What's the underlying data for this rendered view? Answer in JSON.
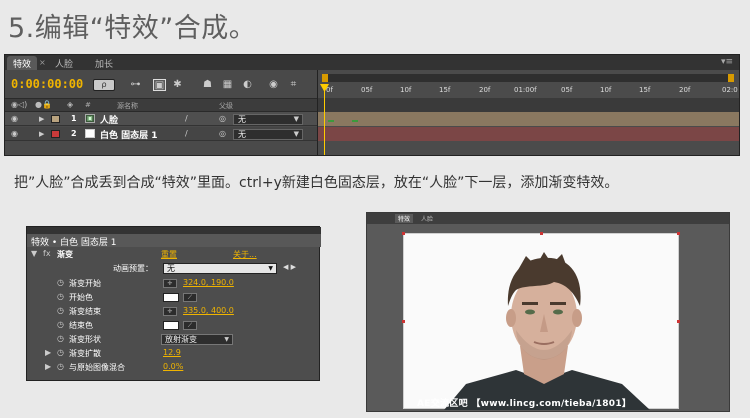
{
  "heading": "5.编辑“特效”合成。",
  "timeline": {
    "tabs": [
      "特效",
      "人脸",
      "加长"
    ],
    "menu_icon": "panel-menu-icon",
    "timecode": "0:00:00:00",
    "search_placeholder": "ρ",
    "columns": {
      "number": "#",
      "source_name": "源名称",
      "parent": "父级"
    },
    "ruler_ticks": [
      "0f",
      "05f",
      "10f",
      "15f",
      "20f",
      "01:00f",
      "05f",
      "10f",
      "15f",
      "20f",
      "02:0"
    ],
    "layers": [
      {
        "num": "1",
        "name": "人脸",
        "color": "#b9a37f",
        "switch": "/",
        "parent": "无"
      },
      {
        "num": "2",
        "name": "白色 固态层 1",
        "color": "#c83a3a",
        "switch": "/",
        "parent": "无"
      }
    ]
  },
  "description": "把”人脸”合成丢到合成“特效”里面。ctrl+y新建白色固态层，放在“人脸”下一层，添加渐变特效。",
  "effect_controls": {
    "header": "特效 • 白色 固态层 1",
    "effect_name": "渐变",
    "reset": "重置",
    "about": "关于...",
    "preset_label": "动画预置：",
    "preset_value": "无",
    "props": [
      {
        "label": "渐变开始",
        "type": "point",
        "value": "324.0, 190.0"
      },
      {
        "label": "开始色",
        "type": "color",
        "value": "#ffffff"
      },
      {
        "label": "渐变结束",
        "type": "point",
        "value": "335.0, 400.0"
      },
      {
        "label": "结束色",
        "type": "color",
        "value": "#ffffff"
      },
      {
        "label": "渐变形状",
        "type": "select",
        "value": "放射渐变"
      },
      {
        "label": "渐变扩散",
        "type": "number",
        "value": "12.9"
      },
      {
        "label": "与原始图像混合",
        "type": "number",
        "value": "0.0%"
      }
    ]
  },
  "preview": {
    "tabs": [
      "特效",
      "人脸"
    ],
    "watermark": "AE交流区吧 【www.lincg.com/tieba/1801】"
  }
}
